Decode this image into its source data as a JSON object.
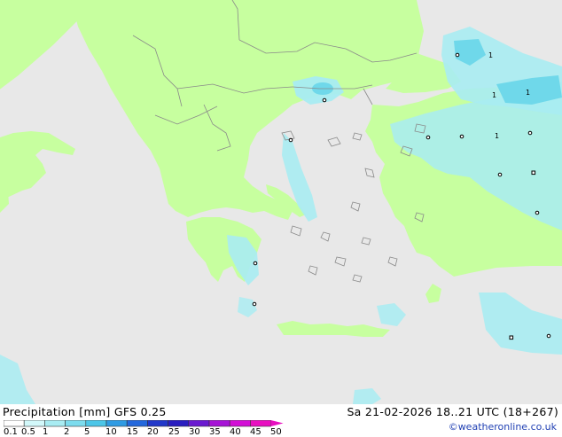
{
  "map": {
    "colors": {
      "sea": "#e8e8e8",
      "land": "#c7ff9f",
      "precip_light": "#a8ecf2",
      "precip_medium": "#6fd8ea",
      "precip_heavy": "#3fb0e0",
      "border": "#8a8a8a"
    },
    "station_labels": [
      "1",
      "1",
      "1",
      "1"
    ]
  },
  "footer": {
    "title": "Precipitation [mm]  GFS 0.25",
    "valid": "Sa 21-02-2026 18..21 UTC (18+267)",
    "credit": "©weatheronline.co.uk"
  },
  "legend": {
    "ticks": [
      "0.1",
      "0.5",
      "1",
      "2",
      "5",
      "10",
      "15",
      "20",
      "25",
      "30",
      "35",
      "40",
      "45",
      "50"
    ],
    "colors": [
      "#ffffff",
      "#d2f8fa",
      "#a8ecf2",
      "#7cdcee",
      "#4cc6e8",
      "#2f9be3",
      "#2468dc",
      "#2138c9",
      "#2a1ec0",
      "#6a1ad0",
      "#a614d6",
      "#d30fd6",
      "#e80fc0"
    ]
  }
}
